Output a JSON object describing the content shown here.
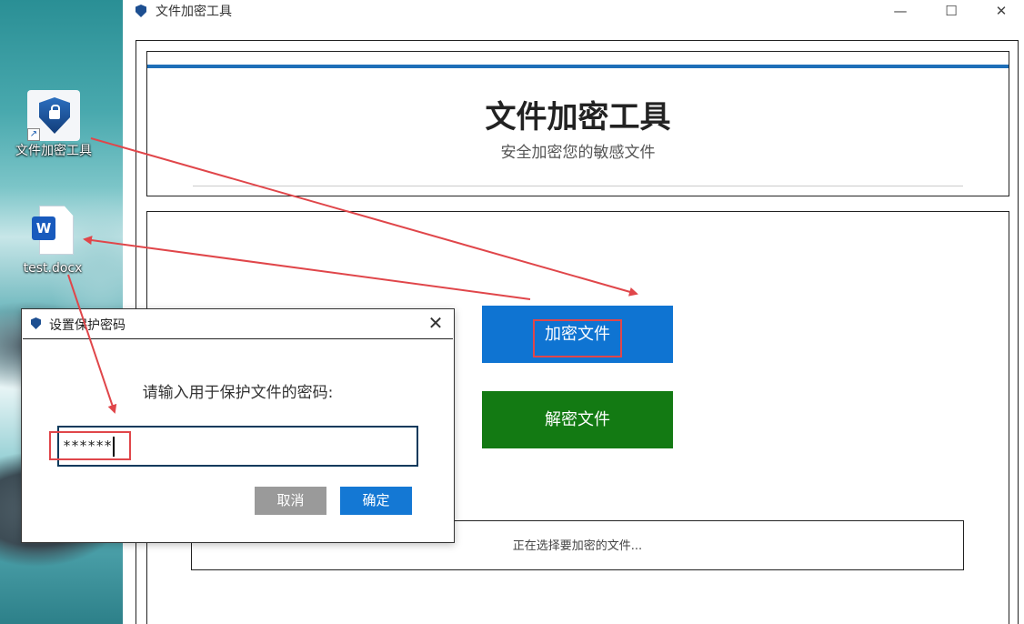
{
  "desktop": {
    "app_shortcut_label": "文件加密工具",
    "doc_label": "test.docx",
    "doc_badge": "W",
    "shortcut_arrow": "↗"
  },
  "window": {
    "title": "文件加密工具",
    "controls": {
      "minimize": "—",
      "maximize": "☐",
      "close": "✕"
    }
  },
  "header": {
    "title": "文件加密工具",
    "subtitle": "安全加密您的敏感文件"
  },
  "actions": {
    "encrypt_label": "加密文件",
    "decrypt_label": "解密文件"
  },
  "status": {
    "text": "正在选择要加密的文件..."
  },
  "dialog": {
    "title": "设置保护密码",
    "close": "✕",
    "prompt": "请输入用于保护文件的密码:",
    "password_value": "******",
    "cancel_label": "取消",
    "ok_label": "确定"
  },
  "colors": {
    "encrypt_button": "#0f74d2",
    "decrypt_button": "#137a13",
    "accent_line": "#1e6fb8",
    "annotation": "#e0464a"
  }
}
